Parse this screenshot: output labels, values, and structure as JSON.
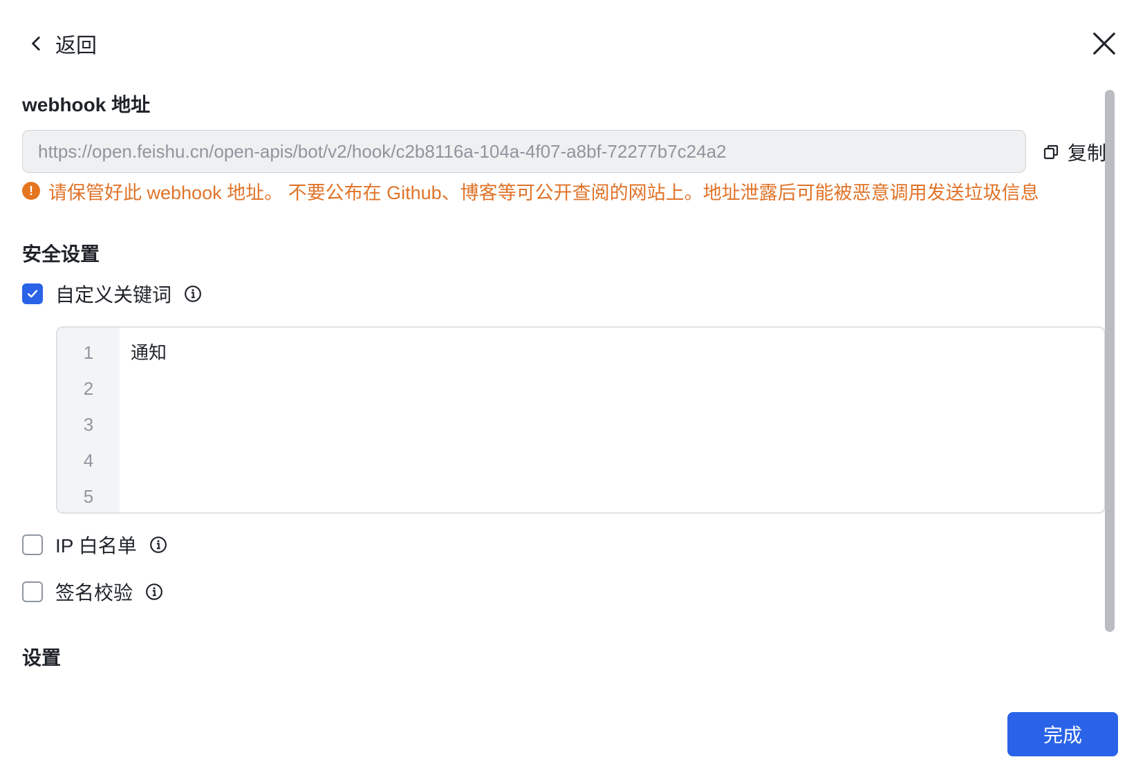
{
  "header": {
    "back_label": "返回",
    "back_icon": "chevron-left-icon",
    "close_icon": "close-icon"
  },
  "webhook": {
    "title": "webhook 地址",
    "url": "https://open.feishu.cn/open-apis/bot/v2/hook/c2b8116a-104a-4f07-a8bf-72277b7c24a2",
    "copy_label": "复制",
    "copy_icon": "copy-icon",
    "warning_icon": "exclamation-icon",
    "warning_text": "请保管好此 webhook 地址。 不要公布在 Github、博客等可公开查阅的网站上。地址泄露后可能被恶意调用发送垃圾信息",
    "warning_color": "#e07328"
  },
  "security": {
    "title": "安全设置",
    "options": [
      {
        "label": "自定义关键词",
        "checked": true
      },
      {
        "label": "IP 白名单",
        "checked": false
      },
      {
        "label": "签名校验",
        "checked": false
      }
    ],
    "keywords_editor": {
      "line_numbers": [
        "1",
        "2",
        "3",
        "4",
        "5"
      ],
      "lines": [
        "通知",
        "",
        "",
        "",
        ""
      ]
    }
  },
  "settings": {
    "title": "设置"
  },
  "footer": {
    "done_label": "完成",
    "accent_color": "#2a63e8"
  }
}
